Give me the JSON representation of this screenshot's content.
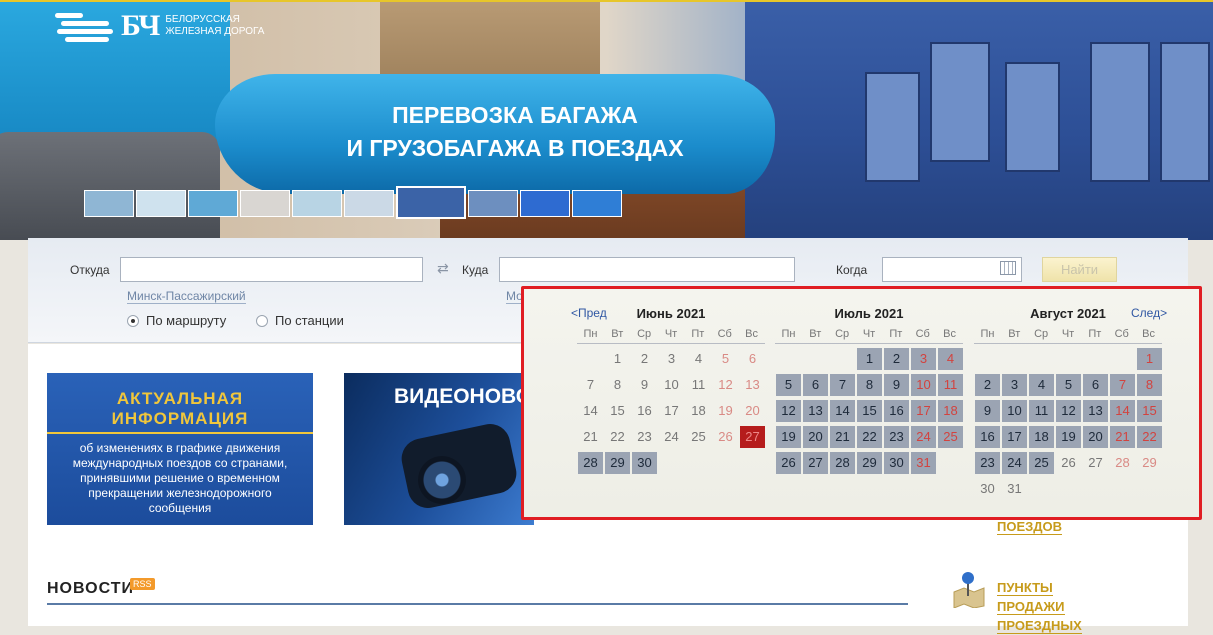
{
  "logo": {
    "abbr": "БЧ",
    "text": [
      "Белорусская",
      "железная дорога"
    ]
  },
  "banner": {
    "title_line1": "ПЕРЕВОЗКА БАГАЖА",
    "title_line2": "И ГРУЗОБАГАЖА В ПОЕЗДАХ",
    "thumbnail_colors": [
      "#8fb6d4",
      "#cfe2ee",
      "#5fa9d6",
      "#d9d6d2",
      "#b8d4e4",
      "#cbd9e6",
      "#3b63a7",
      "#6d8fbf",
      "#2e6bd1",
      "#2f7ed6"
    ]
  },
  "search": {
    "from_label": "Откуда",
    "to_label": "Куда",
    "when_label": "Когда",
    "from_value": "",
    "to_value": "",
    "date_value": "",
    "from_hint": "Минск-Пассажирский",
    "to_hint": "Мо",
    "find_button": "Найти",
    "radio_route": "По маршруту",
    "radio_station": "По станции"
  },
  "calendar": {
    "prev_label": "<Пред",
    "next_label": "След>",
    "weekdays": [
      "Пн",
      "Вт",
      "Ср",
      "Чт",
      "Пт",
      "Сб",
      "Вс"
    ],
    "months": [
      {
        "title": "Июнь 2021",
        "offset": 1,
        "days": 30,
        "available": [
          28,
          29,
          30
        ],
        "today": 27,
        "past_weekend_dim": true
      },
      {
        "title": "Июль 2021",
        "offset": 3,
        "days": 31,
        "available": [
          1,
          2,
          3,
          4,
          5,
          6,
          7,
          8,
          9,
          10,
          11,
          12,
          13,
          14,
          15,
          16,
          17,
          18,
          19,
          20,
          21,
          22,
          23,
          24,
          25,
          26,
          27,
          28,
          29,
          30,
          31
        ],
        "today": null,
        "past_weekend_dim": false
      },
      {
        "title": "Август 2021",
        "offset": 6,
        "days": 31,
        "available": [
          1,
          2,
          3,
          4,
          5,
          6,
          7,
          8,
          9,
          10,
          11,
          12,
          13,
          14,
          15,
          16,
          17,
          18,
          19,
          20,
          21,
          22,
          23,
          24,
          25
        ],
        "today": null,
        "past_weekend_dim": false
      }
    ]
  },
  "cards": {
    "info_header": "АКТУАЛЬНАЯ ИНФОРМАЦИЯ",
    "info_text": "об изменениях в графике движения международных поездов со странами, принявшими решение о временном прекращении железнодорожного сообщения",
    "video_title": "ВИДЕОНОВО"
  },
  "news": {
    "title": "НОВОСТИ",
    "rss": "RSS"
  },
  "sidebar": {
    "link_partial": "ПОЕЗДОВ",
    "sale_points": [
      "ПУНКТЫ",
      "ПРОДАЖИ",
      "ПРОЕЗДНЫХ"
    ]
  }
}
